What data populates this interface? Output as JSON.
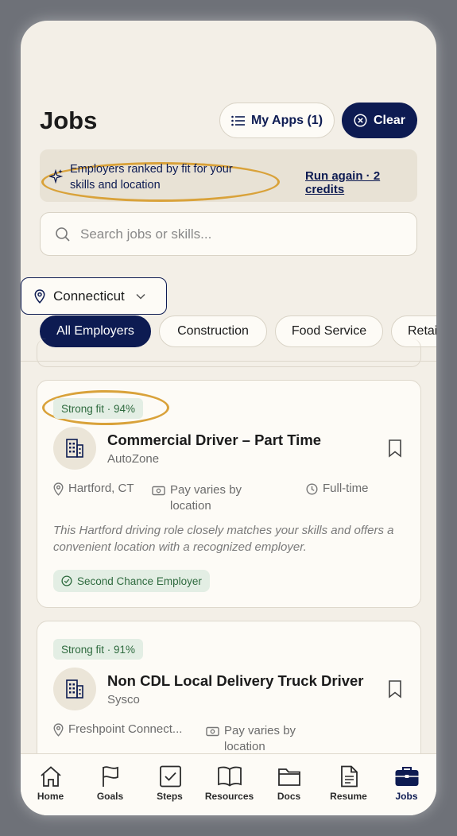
{
  "header": {
    "title": "Jobs",
    "my_apps_label": "My Apps (1)",
    "clear_label": "Clear"
  },
  "banner": {
    "message": "Employers ranked by fit for your skills and location",
    "run_again_label": "Run again · 2 credits"
  },
  "search": {
    "placeholder": "Search jobs or skills..."
  },
  "location": {
    "selected": "Connecticut"
  },
  "filters": [
    {
      "label": "All Employers",
      "active": true
    },
    {
      "label": "Construction",
      "active": false
    },
    {
      "label": "Food Service",
      "active": false
    },
    {
      "label": "Retail",
      "active": false
    }
  ],
  "jobs": [
    {
      "fit": "Strong fit · 94%",
      "title": "Commercial Driver – Part Time",
      "company": "AutoZone",
      "location": "Hartford, CT",
      "pay": "Pay varies by location",
      "type": "Full-time",
      "description": "This Hartford driving role closely matches your skills and offers a convenient location with a recognized employer.",
      "badge": "Second Chance Employer"
    },
    {
      "fit": "Strong fit · 91%",
      "title": "Non CDL Local Delivery Truck Driver",
      "company": "Sysco",
      "location": "Freshpoint Connect...",
      "pay": "Pay varies by location"
    }
  ],
  "nav": [
    {
      "label": "Home",
      "icon": "home-icon"
    },
    {
      "label": "Goals",
      "icon": "flag-icon"
    },
    {
      "label": "Steps",
      "icon": "checkbox-icon"
    },
    {
      "label": "Resources",
      "icon": "book-icon"
    },
    {
      "label": "Docs",
      "icon": "folder-icon"
    },
    {
      "label": "Resume",
      "icon": "document-icon"
    },
    {
      "label": "Jobs",
      "icon": "briefcase-icon",
      "active": true
    }
  ],
  "colors": {
    "accent": "#0d1b52",
    "highlight": "#d9a23a",
    "fit_bg": "#e3eee4",
    "fit_text": "#2f6b3f",
    "background": "#f3efe7"
  }
}
